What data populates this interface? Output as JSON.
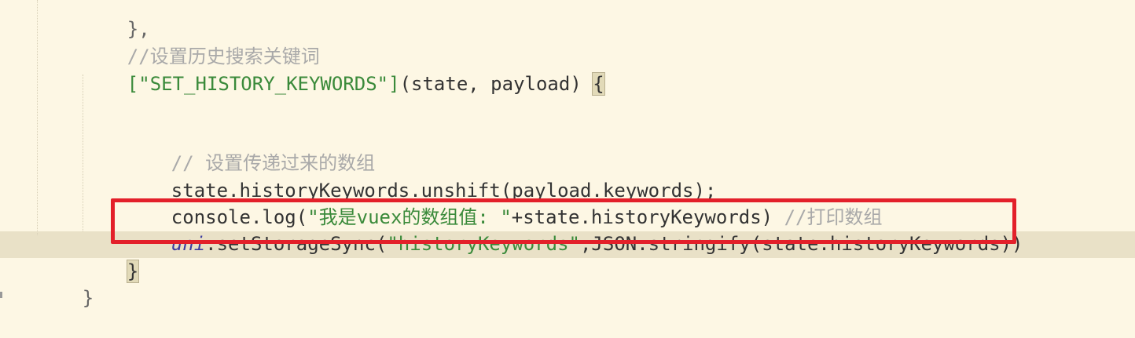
{
  "editor": {
    "lines": {
      "l1": "},",
      "l2": "//设置历史搜索关键词",
      "l3_key": "[\"SET_HISTORY_KEYWORDS\"]",
      "l3_params": "(state, payload) ",
      "l3_brace": "{",
      "l5": "// 设置传递过来的数组",
      "l6": "state.historyKeywords.unshift(payload.keywords);",
      "l7_call": "console.log(",
      "l7_str": "\"我是vuex的数组值: \"",
      "l7_rest": "+state.historyKeywords) ",
      "l7_cmt": "//打印数组",
      "l8_obj": "uni",
      "l8_call": ".setStorageSync(",
      "l8_str": "\"historyKeywords\"",
      "l8_rest": ",JSON.stringify(state.historyKeywords))",
      "l9": "}",
      "l10": "}"
    }
  },
  "colors": {
    "background": "#fdf7e4",
    "current_line": "#e9e1c7",
    "highlight_border": "#e3202a",
    "string": "#3a8a3a",
    "comment": "#a9a9a9"
  }
}
